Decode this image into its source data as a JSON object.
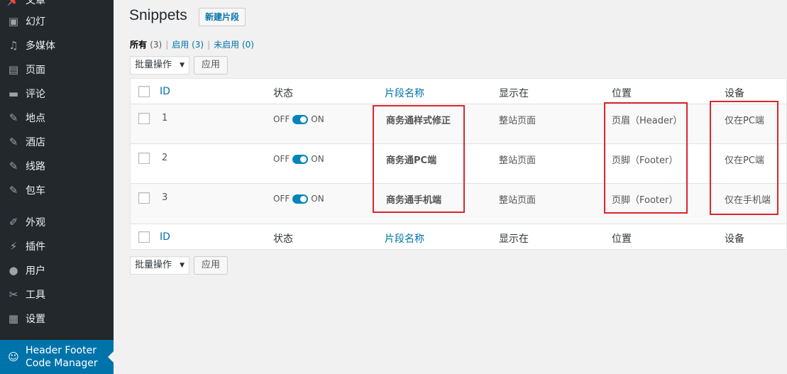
{
  "sidebar": {
    "items": [
      {
        "label": "文章",
        "icon": "pin-icon"
      },
      {
        "label": "幻灯",
        "icon": "slides-icon"
      },
      {
        "label": "多媒体",
        "icon": "media-icon"
      },
      {
        "label": "页面",
        "icon": "page-icon"
      },
      {
        "label": "评论",
        "icon": "comment-icon"
      },
      {
        "label": "地点",
        "icon": "pin-icon"
      },
      {
        "label": "酒店",
        "icon": "pin-icon"
      },
      {
        "label": "线路",
        "icon": "pin-icon"
      },
      {
        "label": "包车",
        "icon": "pin-icon"
      },
      {
        "label": "外观",
        "icon": "brush-icon"
      },
      {
        "label": "插件",
        "icon": "plugin-icon"
      },
      {
        "label": "用户",
        "icon": "user-icon"
      },
      {
        "label": "工具",
        "icon": "wrench-icon"
      },
      {
        "label": "设置",
        "icon": "settings-icon"
      }
    ],
    "active": {
      "line1": "Header Footer",
      "line2": "Code Manager",
      "icon": "code-icon"
    }
  },
  "header": {
    "title": "Snippets",
    "add_new": "新建片段"
  },
  "filters": {
    "all_label": "所有",
    "all_count": "(3)",
    "active_label": "启用",
    "active_count": "(3)",
    "inactive_label": "未启用",
    "inactive_count": "(0)",
    "sep": "|"
  },
  "bulk": {
    "select": "批量操作",
    "apply": "应用"
  },
  "table": {
    "columns": [
      "ID",
      "状态",
      "片段名称",
      "显示在",
      "位置",
      "设备"
    ],
    "off": "OFF",
    "on": "ON",
    "rows": [
      {
        "id": "1",
        "name": "商务通样式修正",
        "display": "整站页面",
        "location": "页眉（Header）",
        "device": "仅在PC端"
      },
      {
        "id": "2",
        "name": "商务通PC端",
        "display": "整站页面",
        "location": "页脚（Footer）",
        "device": "仅在PC端"
      },
      {
        "id": "3",
        "name": "商务通手机端",
        "display": "整站页面",
        "location": "页脚（Footer）",
        "device": "仅在手机端"
      }
    ]
  },
  "colors": {
    "accent": "#0073aa",
    "sidebar_bg": "#23282d",
    "highlight_box": "#d9262c",
    "toggle_on": "#0085ba"
  }
}
